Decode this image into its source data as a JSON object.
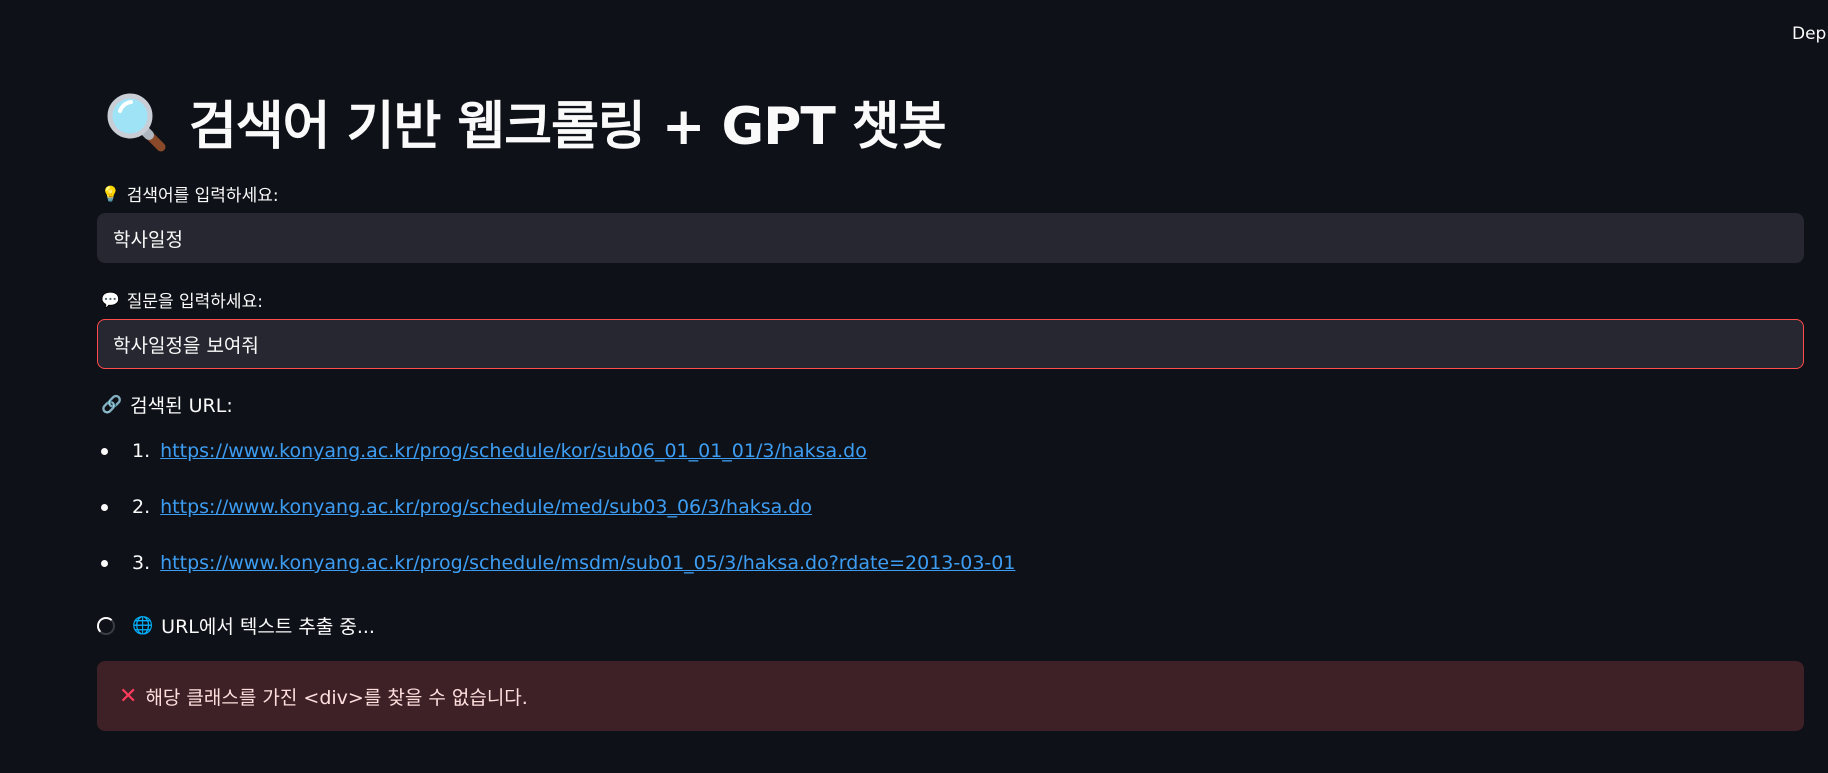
{
  "header": {
    "deploy_label": "Deploy"
  },
  "title": {
    "icon": "magnifier-icon",
    "text": "검색어 기반 웹크롤링 + GPT 챗봇"
  },
  "search_field": {
    "label_icon": "lightbulb-icon",
    "label_emoji": "💡",
    "label": "검색어를 입력하세요:",
    "value": "학사일정"
  },
  "question_field": {
    "label_icon": "speech-bubble-icon",
    "label_emoji": "💬",
    "label": "질문을 입력하세요:",
    "value": "학사일정을 보여줘"
  },
  "urls": {
    "header_icon": "link-icon",
    "header_emoji": "🔗",
    "header": "검색된 URL:",
    "items": [
      {
        "num": "1.",
        "url": "https://www.konyang.ac.kr/prog/schedule/kor/sub06_01_01_01/3/haksa.do"
      },
      {
        "num": "2.",
        "url": "https://www.konyang.ac.kr/prog/schedule/med/sub03_06/3/haksa.do"
      },
      {
        "num": "3.",
        "url": "https://www.konyang.ac.kr/prog/schedule/msdm/sub01_05/3/haksa.do?rdate=2013-03-01"
      }
    ]
  },
  "status": {
    "icon": "globe-icon",
    "emoji": "🌐",
    "text": "URL에서 텍스트 추출 중..."
  },
  "error": {
    "icon": "cross-icon",
    "emoji": "✕",
    "text": "해당 클래스를 가진 <div>를 찾을 수 없습니다."
  },
  "colors": {
    "background": "#0e1117",
    "input_bg": "#262730",
    "focus_border": "#ff4b4b",
    "link": "#3d9df3",
    "error_bg": "#3e2126"
  }
}
